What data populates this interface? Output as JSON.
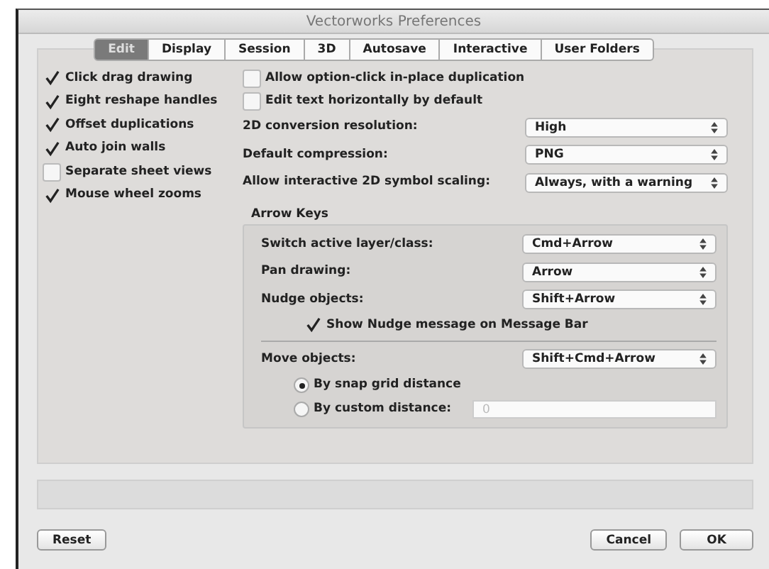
{
  "window": {
    "title": "Vectorworks Preferences"
  },
  "tabs": [
    {
      "label": "Edit",
      "selected": true
    },
    {
      "label": "Display",
      "selected": false
    },
    {
      "label": "Session",
      "selected": false
    },
    {
      "label": "3D",
      "selected": false
    },
    {
      "label": "Autosave",
      "selected": false
    },
    {
      "label": "Interactive",
      "selected": false
    },
    {
      "label": "User Folders",
      "selected": false
    }
  ],
  "left_options": [
    {
      "label": "Click drag drawing",
      "checked": true
    },
    {
      "label": "Eight reshape handles",
      "checked": true
    },
    {
      "label": "Offset duplications",
      "checked": true
    },
    {
      "label": "Auto join walls",
      "checked": true
    },
    {
      "label": "Separate sheet views",
      "checked": false
    },
    {
      "label": "Mouse wheel zooms",
      "checked": true
    }
  ],
  "right_options": [
    {
      "label": "Allow option-click in-place duplication",
      "checked": false
    },
    {
      "label": "Edit text horizontally by default",
      "checked": false
    }
  ],
  "settings": [
    {
      "label": "2D conversion resolution:",
      "value": "High"
    },
    {
      "label": "Default compression:",
      "value": "PNG"
    },
    {
      "label": "Allow interactive 2D symbol scaling:",
      "value": "Always, with a warning"
    }
  ],
  "arrow_keys": {
    "title": "Arrow Keys",
    "settings": [
      {
        "label": "Switch active layer/class:",
        "value": "Cmd+Arrow"
      },
      {
        "label": "Pan drawing:",
        "value": "Arrow"
      },
      {
        "label": "Nudge objects:",
        "value": "Shift+Arrow"
      }
    ],
    "show_nudge": {
      "label": "Show Nudge message on Message Bar",
      "checked": true
    },
    "move": {
      "label": "Move objects:",
      "value": "Shift+Cmd+Arrow"
    },
    "distance": [
      {
        "label": "By snap grid distance",
        "selected": true
      },
      {
        "label": "By custom distance:",
        "selected": false
      }
    ],
    "custom_distance": {
      "placeholder": "0"
    }
  },
  "buttons": {
    "reset": "Reset",
    "cancel": "Cancel",
    "ok": "OK"
  }
}
